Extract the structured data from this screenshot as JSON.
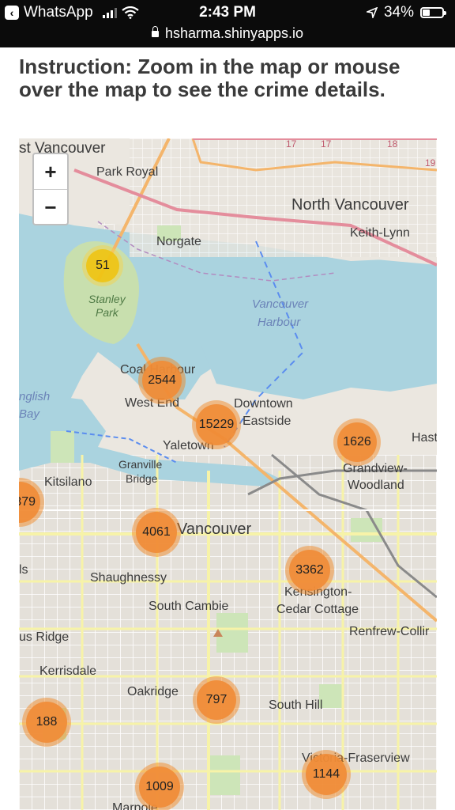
{
  "status_bar": {
    "back_app": "WhatsApp",
    "time": "2:43 PM",
    "battery": "34%",
    "battery_level": 0.34,
    "url": "hsharma.shinyapps.io"
  },
  "instruction": "Instruction: Zoom in the map or mouse over the map to see the crime details.",
  "map": {
    "zoom_in": "+",
    "zoom_out": "−",
    "labels": {
      "west_vancouver": "st Vancouver",
      "park_royal": "Park Royal",
      "north_vancouver": "North Vancouver",
      "keith_lynn": "Keith-Lynn",
      "norgate": "Norgate",
      "stanley_park_1": "Stanley",
      "stanley_park_2": "Park",
      "vancouver_harbour_1": "Vancouver",
      "vancouver_harbour_2": "Harbour",
      "coal_harbour": "Coal Harbour",
      "english_bay_1": "nglish",
      "english_bay_2": "Bay",
      "west_end": "West End",
      "downtown_eastside_1": "Downtown",
      "downtown_eastside_2": "Eastside",
      "yaletown": "Yaletown",
      "granville_bridge_1": "Granville",
      "granville_bridge_2": "Bridge",
      "kitsilano": "Kitsilano",
      "hastings": "Hast",
      "grandview_1": "Grandview-",
      "grandview_2": "Woodland",
      "vancouver": "Vancouver",
      "shaughnessy": "Shaughnessy",
      "kensington_1": "Kensington-",
      "kensington_2": "Cedar Cottage",
      "south_cambie": "South Cambie",
      "renfrew": "Renfrew-Collir",
      "dunbar_ridge": "us Ridge",
      "kerrisdale": "Kerrisdale",
      "oakridge": "Oakridge",
      "south_hill": "South Hill",
      "victoria": "Victoria-Fraserview",
      "marpole": "Marpole",
      "ls": "ls",
      "route_17a": "17",
      "route_17b": "17",
      "route_18": "18",
      "route_19": "19"
    },
    "clusters": {
      "stanley_park": "51",
      "coal_harbour": "2544",
      "downtown": "15229",
      "grandview": "1626",
      "kitsilano": "379",
      "vancouver": "4061",
      "kensington": "3362",
      "south_cambie_hill": "797",
      "kerrisdale": "188",
      "marpole": "1009",
      "victoria": "1144"
    }
  }
}
